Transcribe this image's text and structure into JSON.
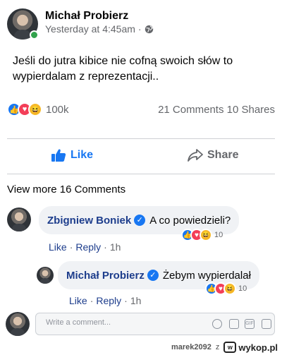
{
  "post": {
    "author": "Michał Probierz",
    "timestamp": "Yesterday at 4:45am",
    "privacy_icon": "globe-icon",
    "text": "Jeśli do jutra kibice nie cofną swoich słów to wypierdalam z reprezentacji..",
    "reactions": [
      "like",
      "love",
      "haha"
    ],
    "reaction_count": "100k",
    "comments_shares": "21 Comments 10 Shares"
  },
  "actions": {
    "like_label": "Like",
    "share_label": "Share"
  },
  "view_more": "View more 16 Comments",
  "comments": [
    {
      "author": "Zbigniew Boniek",
      "text": "A co powiedzieli?",
      "reaction_count": "10",
      "like_label": "Like",
      "reply_label": "Reply",
      "time": "1h"
    },
    {
      "author": "Michał Probierz",
      "text": "Żebym wypierdalał",
      "reaction_count": "10",
      "like_label": "Like",
      "reply_label": "Reply",
      "time": "1h"
    }
  ],
  "composer": {
    "placeholder": "Write a comment..."
  },
  "watermark": {
    "user": "marek2092",
    "connector": "z",
    "site": "wykop.pl"
  },
  "colors": {
    "accent": "#1877f2",
    "name_link": "#1d3d8c",
    "online": "#31a24c"
  }
}
